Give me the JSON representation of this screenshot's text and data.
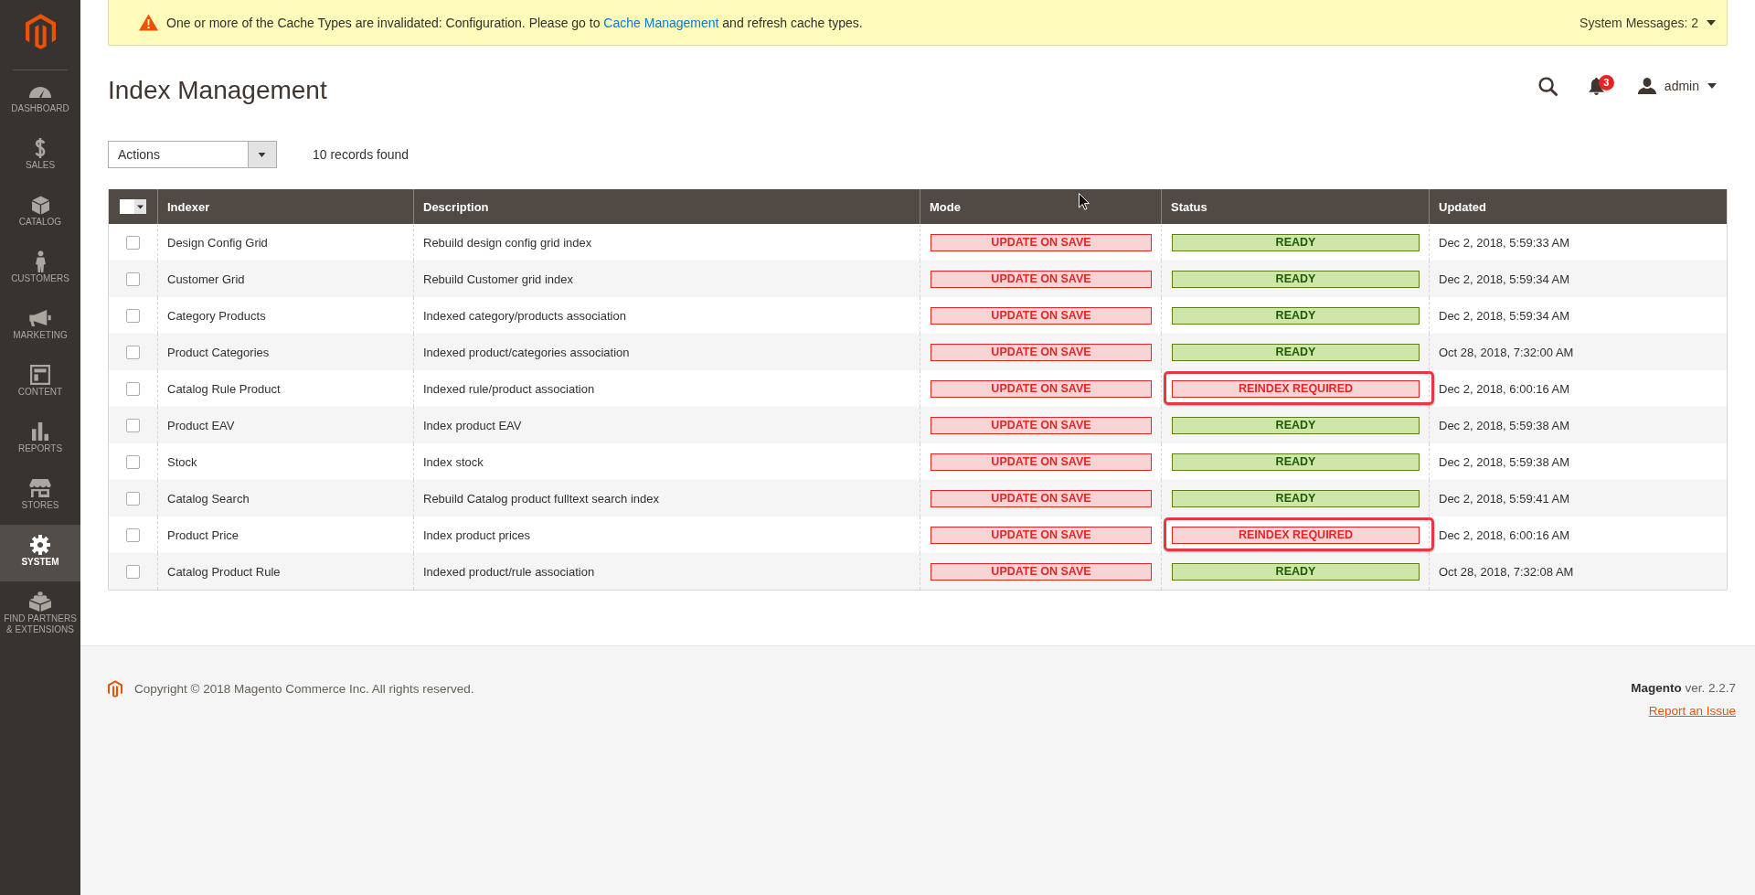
{
  "sidebar": {
    "items": [
      {
        "label": "DASHBOARD",
        "selected": false
      },
      {
        "label": "SALES",
        "selected": false
      },
      {
        "label": "CATALOG",
        "selected": false
      },
      {
        "label": "CUSTOMERS",
        "selected": false
      },
      {
        "label": "MARKETING",
        "selected": false
      },
      {
        "label": "CONTENT",
        "selected": false
      },
      {
        "label": "REPORTS",
        "selected": false
      },
      {
        "label": "STORES",
        "selected": false
      },
      {
        "label": "SYSTEM",
        "selected": true
      },
      {
        "label": "FIND PARTNERS & EXTENSIONS",
        "selected": false
      }
    ]
  },
  "system_message": {
    "text_before": "One or more of the Cache Types are invalidated: Configuration. Please go to",
    "link": "Cache Management",
    "text_after": "and refresh cache types.",
    "messages_toggle": "System Messages: 2"
  },
  "page_header": {
    "title": "Index Management",
    "notifications_count": "3",
    "user": "admin"
  },
  "toolbar": {
    "actions_select": "Actions",
    "records": "10 records found"
  },
  "table": {
    "select_all": {
      "checked": false
    },
    "columns": [
      "Indexer",
      "Description",
      "Mode",
      "Status",
      "Updated"
    ],
    "rows": [
      {
        "checked": false,
        "indexer": "Design Config Grid",
        "description": "Rebuild design config grid index",
        "mode": {
          "text": "UPDATE ON SAVE",
          "kind": "critical"
        },
        "status": {
          "text": "READY",
          "kind": "notice"
        },
        "updated": "Dec 2, 2018, 5:59:33 AM",
        "highlighted": false
      },
      {
        "checked": false,
        "indexer": "Customer Grid",
        "description": "Rebuild Customer grid index",
        "mode": {
          "text": "UPDATE ON SAVE",
          "kind": "critical"
        },
        "status": {
          "text": "READY",
          "kind": "notice"
        },
        "updated": "Dec 2, 2018, 5:59:34 AM",
        "highlighted": false
      },
      {
        "checked": false,
        "indexer": "Category Products",
        "description": "Indexed category/products association",
        "mode": {
          "text": "UPDATE ON SAVE",
          "kind": "critical"
        },
        "status": {
          "text": "READY",
          "kind": "notice"
        },
        "updated": "Dec 2, 2018, 5:59:34 AM",
        "highlighted": false
      },
      {
        "checked": false,
        "indexer": "Product Categories",
        "description": "Indexed product/categories association",
        "mode": {
          "text": "UPDATE ON SAVE",
          "kind": "critical"
        },
        "status": {
          "text": "READY",
          "kind": "notice"
        },
        "updated": "Oct 28, 2018, 7:32:00 AM",
        "highlighted": false
      },
      {
        "checked": false,
        "indexer": "Catalog Rule Product",
        "description": "Indexed rule/product association",
        "mode": {
          "text": "UPDATE ON SAVE",
          "kind": "critical"
        },
        "status": {
          "text": "REINDEX REQUIRED",
          "kind": "critical"
        },
        "updated": "Dec 2, 2018, 6:00:16 AM",
        "highlighted": true
      },
      {
        "checked": false,
        "indexer": "Product EAV",
        "description": "Index product EAV",
        "mode": {
          "text": "UPDATE ON SAVE",
          "kind": "critical"
        },
        "status": {
          "text": "READY",
          "kind": "notice"
        },
        "updated": "Dec 2, 2018, 5:59:38 AM",
        "highlighted": false
      },
      {
        "checked": false,
        "indexer": "Stock",
        "description": "Index stock",
        "mode": {
          "text": "UPDATE ON SAVE",
          "kind": "critical"
        },
        "status": {
          "text": "READY",
          "kind": "notice"
        },
        "updated": "Dec 2, 2018, 5:59:38 AM",
        "highlighted": false
      },
      {
        "checked": false,
        "indexer": "Catalog Search",
        "description": "Rebuild Catalog product fulltext search index",
        "mode": {
          "text": "UPDATE ON SAVE",
          "kind": "critical"
        },
        "status": {
          "text": "READY",
          "kind": "notice"
        },
        "updated": "Dec 2, 2018, 5:59:41 AM",
        "highlighted": false
      },
      {
        "checked": false,
        "indexer": "Product Price",
        "description": "Index product prices",
        "mode": {
          "text": "UPDATE ON SAVE",
          "kind": "critical"
        },
        "status": {
          "text": "REINDEX REQUIRED",
          "kind": "critical"
        },
        "updated": "Dec 2, 2018, 6:00:16 AM",
        "highlighted": true
      },
      {
        "checked": false,
        "indexer": "Catalog Product Rule",
        "description": "Indexed product/rule association",
        "mode": {
          "text": "UPDATE ON SAVE",
          "kind": "critical"
        },
        "status": {
          "text": "READY",
          "kind": "notice"
        },
        "updated": "Oct 28, 2018, 7:32:08 AM",
        "highlighted": false
      }
    ]
  },
  "footer": {
    "copyright": "Copyright © 2018 Magento Commerce Inc. All rights reserved.",
    "version": "**Magento** ver. 2.2.7",
    "report_link": "Report an Issue"
  }
}
